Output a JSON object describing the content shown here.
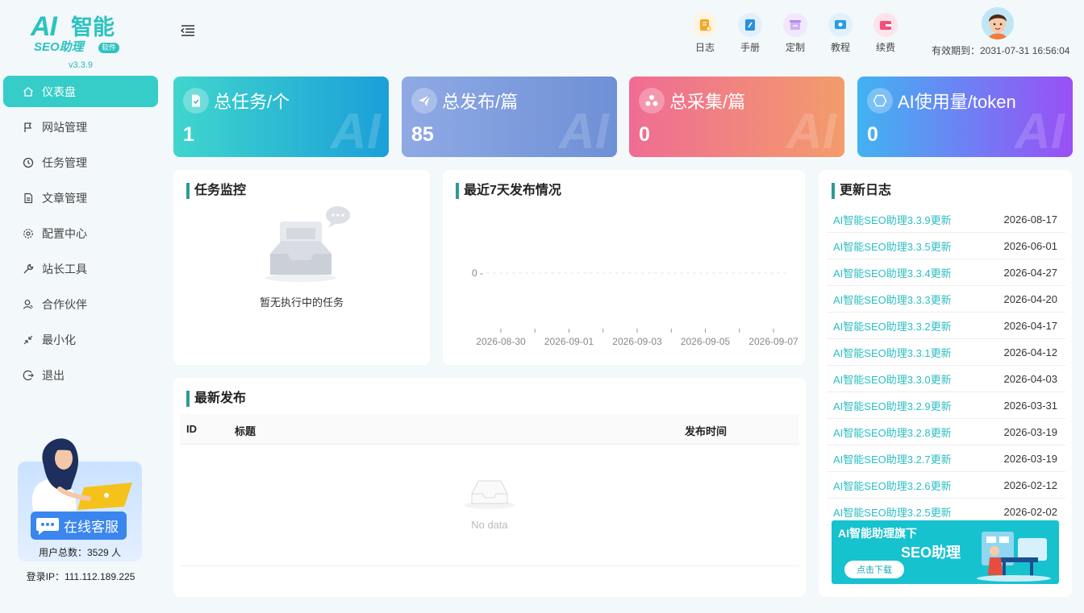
{
  "brand": {
    "ai": "AI",
    "zh": "智能",
    "seo": "SEO助理",
    "tag": "软件",
    "version": "v3.3.9"
  },
  "sidebar": {
    "items": [
      {
        "label": "仪表盘",
        "icon": "home-icon",
        "active": true
      },
      {
        "label": "网站管理",
        "icon": "flag-icon"
      },
      {
        "label": "任务管理",
        "icon": "clock-icon"
      },
      {
        "label": "文章管理",
        "icon": "document-icon"
      },
      {
        "label": "配置中心",
        "icon": "gear-icon"
      },
      {
        "label": "站长工具",
        "icon": "wrench-icon"
      },
      {
        "label": "合作伙伴",
        "icon": "user-icon"
      },
      {
        "label": "最小化",
        "icon": "minimize-icon"
      },
      {
        "label": "退出",
        "icon": "logout-icon"
      }
    ],
    "service_label": "在线客服",
    "users_label": "用户总数：3529 人",
    "login_ip": "登录IP：111.112.189.225"
  },
  "header": {
    "actions": [
      {
        "label": "日志",
        "icon": "log-icon",
        "color": "#f5a623",
        "bg": "#fff4e0"
      },
      {
        "label": "手册",
        "icon": "manual-icon",
        "color": "#2a8fe0",
        "bg": "#e1f0fc"
      },
      {
        "label": "定制",
        "icon": "custom-icon",
        "color": "#b68af0",
        "bg": "#f1e8fd"
      },
      {
        "label": "教程",
        "icon": "tutorial-icon",
        "color": "#2a9be8",
        "bg": "#e1f1fc"
      },
      {
        "label": "续费",
        "icon": "renew-icon",
        "color": "#f0507a",
        "bg": "#fde4ea"
      }
    ],
    "expire": "有效期到：2031-07-31 16:56:04"
  },
  "stats": [
    {
      "title": "总任务/个",
      "value": "1",
      "icon": "task-check-icon",
      "from": "#3fd6cd",
      "to": "#1b9fd8"
    },
    {
      "title": "总发布/篇",
      "value": "85",
      "icon": "paper-plane-icon",
      "from": "#8fa9e4",
      "to": "#6e90d6"
    },
    {
      "title": "总采集/篇",
      "value": "0",
      "icon": "collect-icon",
      "from": "#ef6c94",
      "to": "#f39c6b"
    },
    {
      "title": "AI使用量/token",
      "value": "0",
      "icon": "ai-token-icon",
      "from": "#41b3f2",
      "to": "#9a4ff5"
    }
  ],
  "watermark": "AI",
  "task_monitor": {
    "title": "任务监控",
    "empty": "暂无执行中的任务"
  },
  "publish_chart": {
    "title": "最近7天发布情况"
  },
  "chart_data": {
    "type": "line",
    "title": "最近7天发布情况",
    "categories": [
      "2026-08-30",
      "2026-09-01",
      "2026-09-03",
      "2026-09-05",
      "2026-09-07"
    ],
    "y_ticks": [
      "0"
    ],
    "series": [
      {
        "values": [
          0,
          0,
          0,
          0,
          0
        ]
      }
    ],
    "grid": "dashed"
  },
  "latest": {
    "title": "最新发布",
    "columns": [
      "ID",
      "标题",
      "发布时间"
    ],
    "empty": "No data"
  },
  "changelog": {
    "title": "更新日志",
    "items": [
      {
        "title": "AI智能SEO助理3.3.9更新",
        "date": "2026-08-17"
      },
      {
        "title": "AI智能SEO助理3.3.5更新",
        "date": "2026-06-01"
      },
      {
        "title": "AI智能SEO助理3.3.4更新",
        "date": "2026-04-27"
      },
      {
        "title": "AI智能SEO助理3.3.3更新",
        "date": "2026-04-20"
      },
      {
        "title": "AI智能SEO助理3.3.2更新",
        "date": "2026-04-17"
      },
      {
        "title": "AI智能SEO助理3.3.1更新",
        "date": "2026-04-12"
      },
      {
        "title": "AI智能SEO助理3.3.0更新",
        "date": "2026-04-03"
      },
      {
        "title": "AI智能SEO助理3.2.9更新",
        "date": "2026-03-31"
      },
      {
        "title": "AI智能SEO助理3.2.8更新",
        "date": "2026-03-19"
      },
      {
        "title": "AI智能SEO助理3.2.7更新",
        "date": "2026-03-19"
      },
      {
        "title": "AI智能SEO助理3.2.6更新",
        "date": "2026-02-12"
      },
      {
        "title": "AI智能SEO助理3.2.5更新",
        "date": "2026-02-02"
      }
    ],
    "banner": {
      "line1": "AI智能助理旗下",
      "line2": "SEO助理",
      "button": "点击下载"
    }
  }
}
